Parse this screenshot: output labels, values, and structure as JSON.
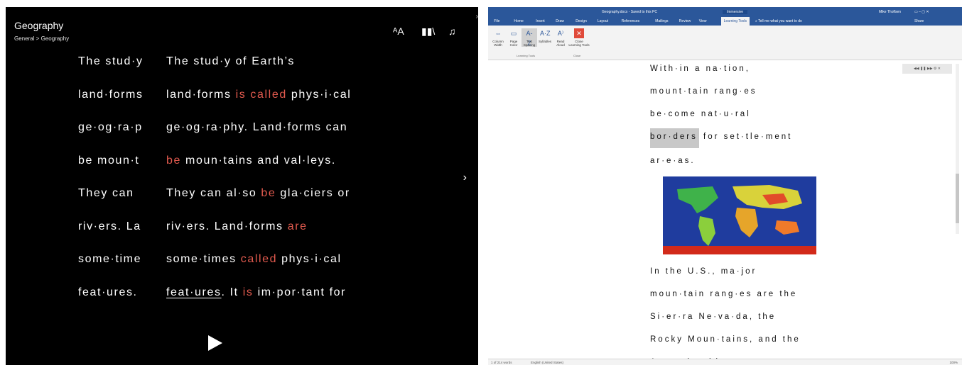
{
  "reader": {
    "title": "Geography",
    "breadcrumb": "General > Geography",
    "lines": [
      {
        "ghost": "The stud·y",
        "segments": [
          {
            "t": "The stud·y of Earth’s",
            "s": ""
          }
        ]
      },
      {
        "ghost": "land·forms",
        "segments": [
          {
            "t": "land·forms ",
            "s": ""
          },
          {
            "t": "is called",
            "s": "hl"
          },
          {
            "t": " phys·i·cal",
            "s": ""
          }
        ]
      },
      {
        "ghost": "ge·og·ra·p",
        "segments": [
          {
            "t": "ge·og·ra·phy. Land·forms can",
            "s": ""
          }
        ]
      },
      {
        "ghost": "be moun·t",
        "segments": [
          {
            "t": "be",
            "s": "hl"
          },
          {
            "t": " moun·tains and val·leys.",
            "s": ""
          }
        ]
      },
      {
        "ghost": "They can ",
        "segments": [
          {
            "t": "They can al·so ",
            "s": ""
          },
          {
            "t": "be",
            "s": "hl"
          },
          {
            "t": " gla·ciers or",
            "s": ""
          }
        ]
      },
      {
        "ghost": "riv·ers. La",
        "segments": [
          {
            "t": "riv·ers. Land·forms ",
            "s": ""
          },
          {
            "t": "are",
            "s": "hl"
          }
        ]
      },
      {
        "ghost": "some·time",
        "segments": [
          {
            "t": "some·times ",
            "s": ""
          },
          {
            "t": "called",
            "s": "hl"
          },
          {
            "t": " phys·i·cal",
            "s": ""
          }
        ]
      },
      {
        "ghost": "feat·ures.",
        "segments": [
          {
            "t": "feat·ures",
            "s": "ul"
          },
          {
            "t": ". It ",
            "s": ""
          },
          {
            "t": "is",
            "s": "hl"
          },
          {
            "t": " im·por·tant for",
            "s": ""
          }
        ]
      }
    ]
  },
  "word": {
    "doc_title": "Geography.docx - Saved to this PC",
    "mode_label": "Immersive",
    "user": "Mike Tholfsen",
    "tabs": [
      "File",
      "Home",
      "Insert",
      "Draw",
      "Design",
      "Layout",
      "References",
      "Mailings",
      "Review",
      "View",
      "Learning Tools"
    ],
    "tell_me": "Tell me what you want to do",
    "share": "Share",
    "ribbon": {
      "buttons": [
        "Column Width",
        "Page Color",
        "Text Spacing",
        "Syllables",
        "Read Aloud",
        "Close Learning Tools"
      ],
      "group_learning": "Learning Tools",
      "group_close": "Close"
    },
    "doc_lines": [
      {
        "t": "With·in a na·tion,",
        "pre": "",
        "hl": ""
      },
      {
        "t": "mount·tain rang·es",
        "pre": "",
        "hl": ""
      },
      {
        "t": "be·come nat·u·ral",
        "pre": "",
        "hl": ""
      },
      {
        "t": " for set·tle·ment",
        "pre": "",
        "hl": "bor·ders"
      },
      {
        "t": "ar·e·as.",
        "pre": "",
        "hl": ""
      },
      {
        "t": "In the U.S., ma·jor",
        "pre": "",
        "hl": ""
      },
      {
        "t": "moun·tain rang·es are the",
        "pre": "",
        "hl": ""
      },
      {
        "t": "Si·er·ra Ne·va·da, the",
        "pre": "",
        "hl": ""
      },
      {
        "t": "Rocky Moun·tains, and the",
        "pre": "",
        "hl": ""
      },
      {
        "t": "Ap·pa·la·chi·ans",
        "pre": "",
        "hl": ""
      }
    ],
    "status_pages": "1 of 214 words",
    "status_lang": "English (United States)",
    "zoom": "100%"
  }
}
